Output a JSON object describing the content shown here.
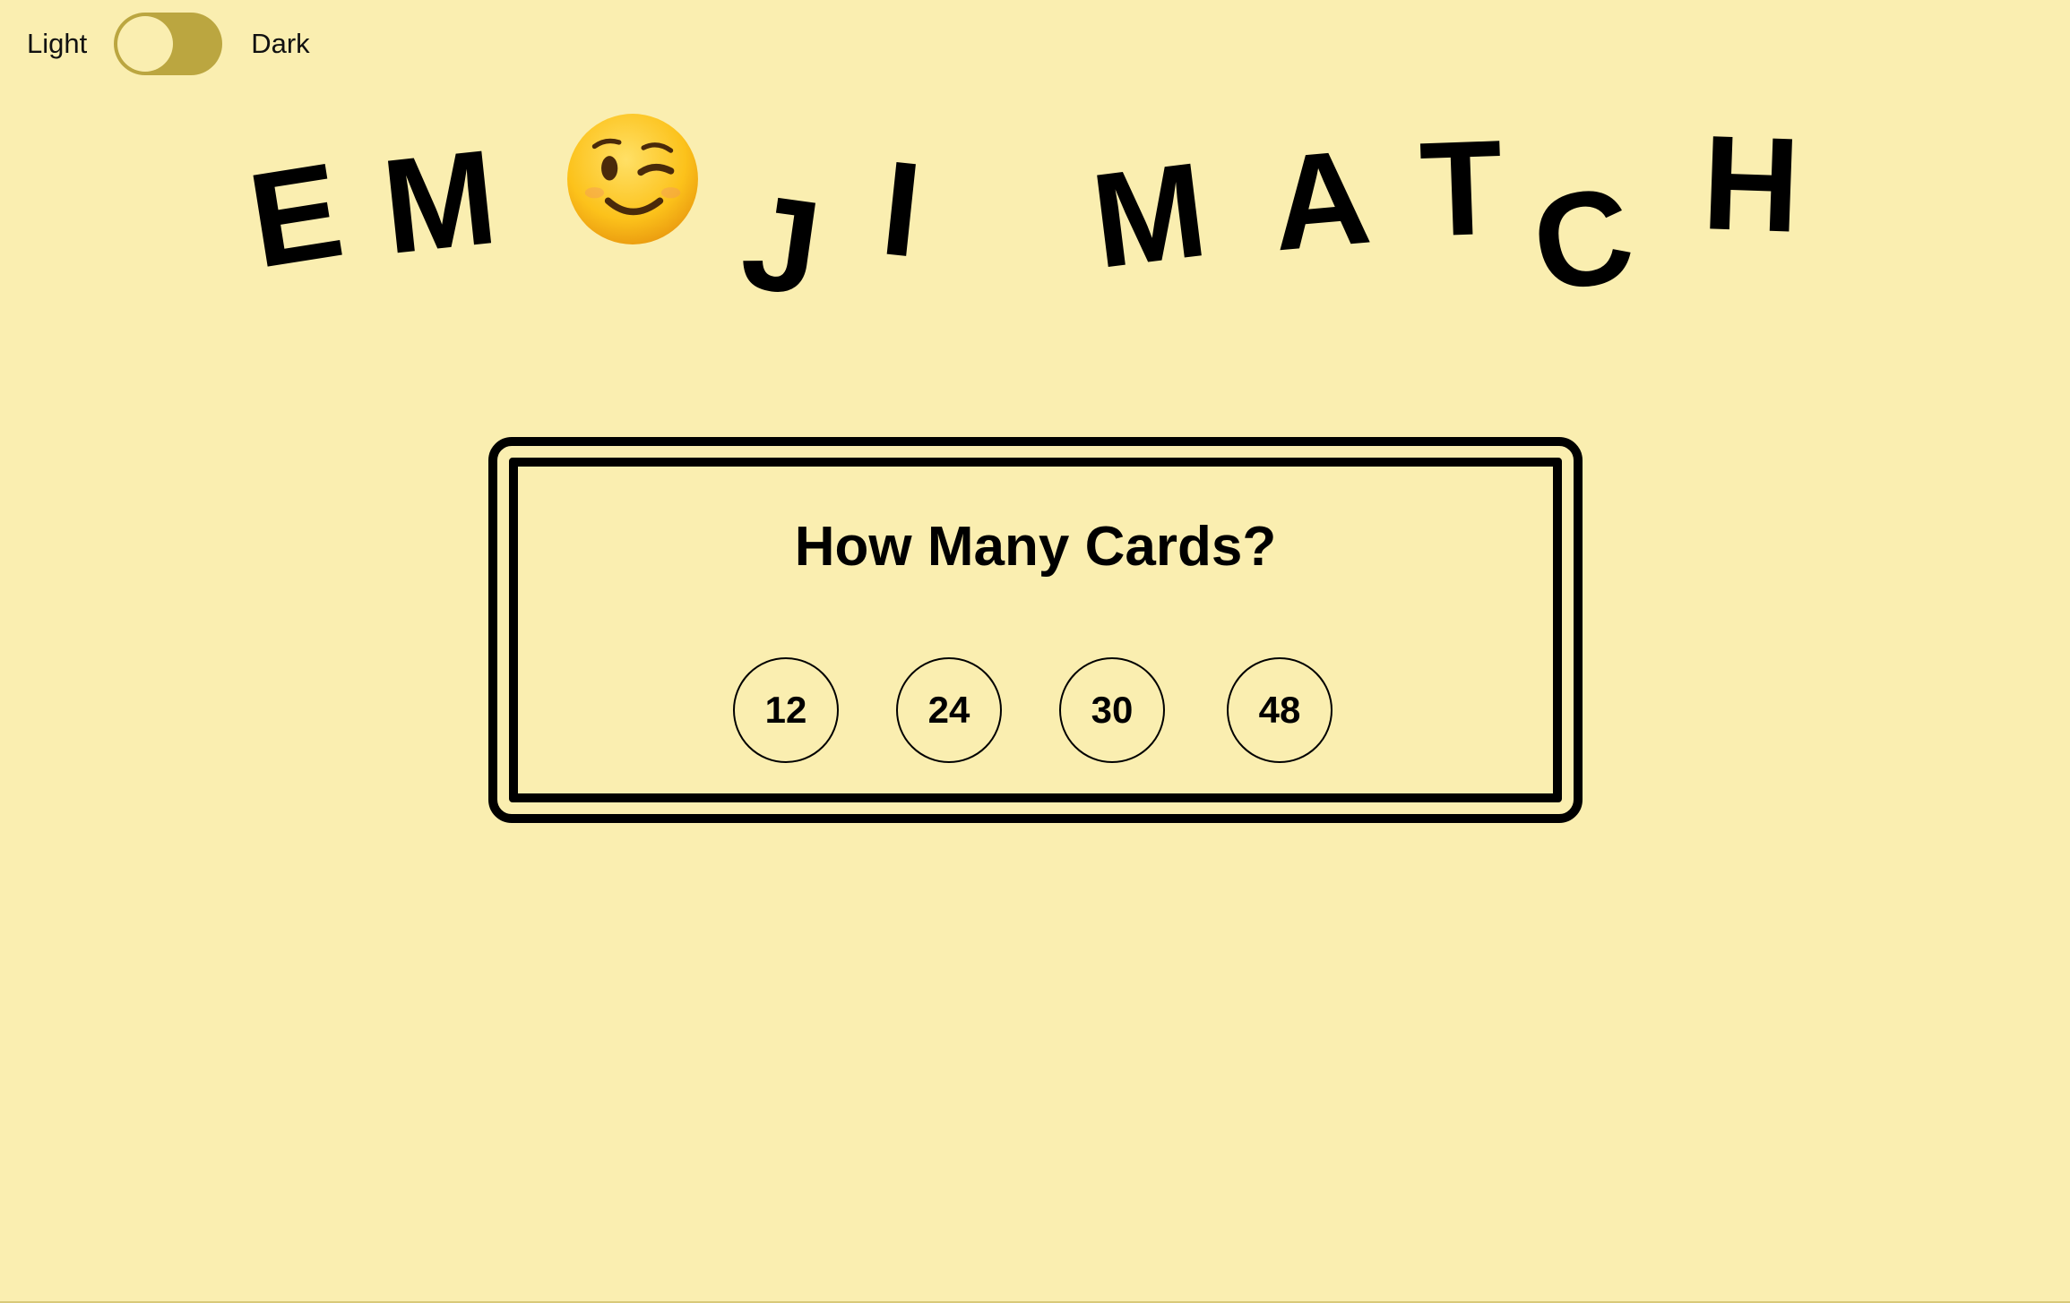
{
  "theme_toggle": {
    "light_label": "Light",
    "dark_label": "Dark",
    "is_dark": false
  },
  "title": {
    "letters": [
      "E",
      "M",
      "J",
      "I",
      "M",
      "A",
      "T",
      "C",
      "H"
    ],
    "emoji_icon": "winking-face-emoji"
  },
  "panel": {
    "heading": "How Many Cards?",
    "options": [
      "12",
      "24",
      "30",
      "48"
    ]
  },
  "colors": {
    "background": "#faeeb0",
    "toggle_track": "#bba640",
    "ink": "#000000"
  }
}
